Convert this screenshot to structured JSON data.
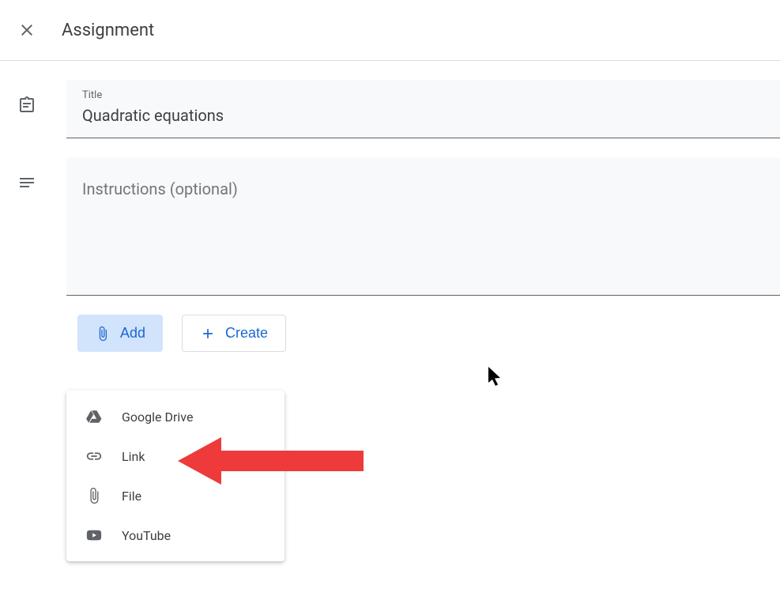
{
  "header": {
    "title": "Assignment"
  },
  "title_field": {
    "label": "Title",
    "value": "Quadratic equations"
  },
  "instructions_field": {
    "placeholder": "Instructions (optional)"
  },
  "buttons": {
    "add": "Add",
    "create": "Create"
  },
  "dropdown": {
    "items": [
      {
        "label": "Google Drive"
      },
      {
        "label": "Link"
      },
      {
        "label": "File"
      },
      {
        "label": "YouTube"
      }
    ]
  }
}
